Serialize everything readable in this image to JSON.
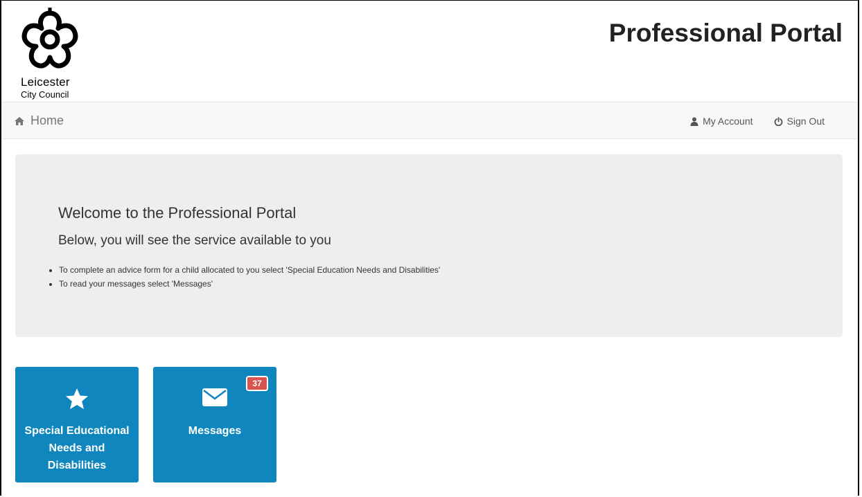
{
  "header": {
    "logo_line1": "Leicester",
    "logo_line2": "City Council",
    "title": "Professional Portal"
  },
  "navbar": {
    "home_icon": "home-icon",
    "home_label": "Home",
    "links": [
      {
        "icon": "user-icon",
        "label": "My Account"
      },
      {
        "icon": "power-icon",
        "label": "Sign Out"
      }
    ]
  },
  "welcome": {
    "title": "Welcome to the Professional Portal",
    "subtitle": "Below, you will see the service available to you",
    "bullets": [
      "To complete an advice form for a child allocated to you select 'Special Education Needs and Disabilities'",
      "To read your messages select 'Messages'"
    ]
  },
  "tiles": [
    {
      "icon": "star-icon",
      "label": "Special Educational Needs and Disabilities"
    },
    {
      "icon": "envelope-icon",
      "label": "Messages",
      "badge": "37"
    }
  ],
  "colors": {
    "tile_bg": "#0f86bd",
    "badge_bg": "#d9534f",
    "panel_bg": "#eeeeee",
    "navbar_bg": "#f8f8f8"
  }
}
